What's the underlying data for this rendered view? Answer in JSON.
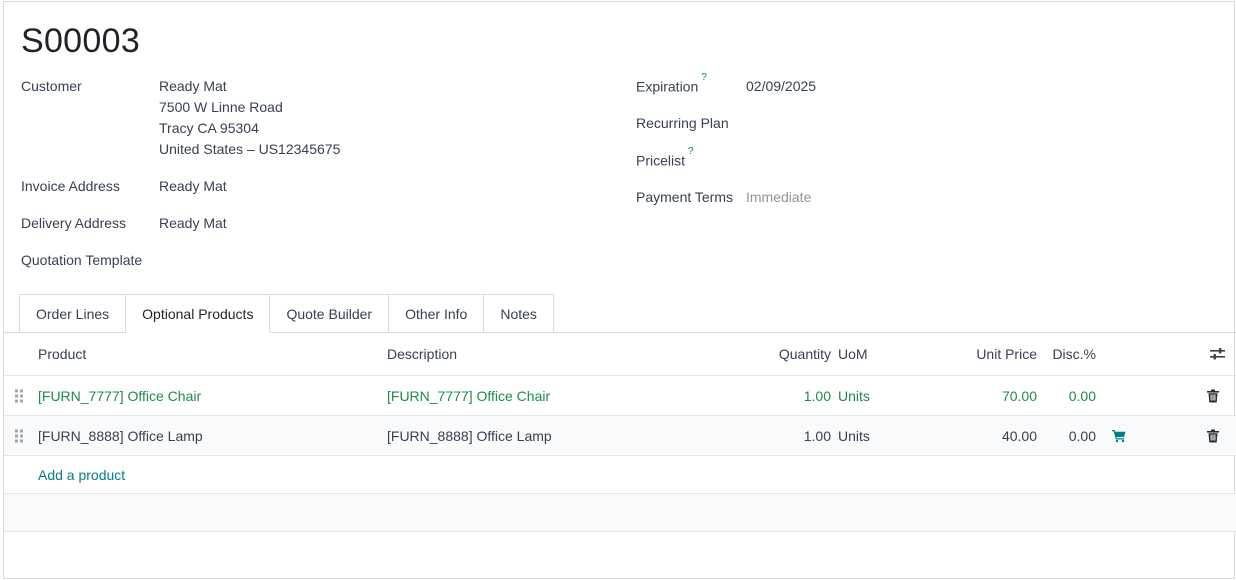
{
  "record": {
    "title": "S00003"
  },
  "left_fields": {
    "customer": {
      "label": "Customer",
      "lines": [
        "Ready Mat",
        "7500 W Linne Road",
        "Tracy CA 95304",
        "United States – US12345675"
      ]
    },
    "invoice_address": {
      "label": "Invoice Address",
      "value": "Ready Mat"
    },
    "delivery_address": {
      "label": "Delivery Address",
      "value": "Ready Mat"
    },
    "quotation_template": {
      "label": "Quotation Template",
      "value": ""
    }
  },
  "right_fields": {
    "expiration": {
      "label": "Expiration",
      "help": "?",
      "value": "02/09/2025"
    },
    "recurring_plan": {
      "label": "Recurring Plan",
      "value": ""
    },
    "pricelist": {
      "label": "Pricelist",
      "help": "?",
      "value": ""
    },
    "payment_terms": {
      "label": "Payment Terms",
      "placeholder": "Immediate"
    }
  },
  "tabs": [
    {
      "label": "Order Lines",
      "active": false
    },
    {
      "label": "Optional Products",
      "active": true
    },
    {
      "label": "Quote Builder",
      "active": false
    },
    {
      "label": "Other Info",
      "active": false
    },
    {
      "label": "Notes",
      "active": false
    }
  ],
  "table": {
    "headers": {
      "product": "Product",
      "description": "Description",
      "quantity": "Quantity",
      "uom": "UoM",
      "unit_price": "Unit Price",
      "discount": "Disc.%"
    },
    "rows": [
      {
        "product": "[FURN_7777] Office Chair",
        "description": "[FURN_7777] Office Chair",
        "quantity": "1.00",
        "uom": "Units",
        "unit_price": "70.00",
        "discount": "0.00",
        "added": true
      },
      {
        "product": "[FURN_8888] Office Lamp",
        "description": "[FURN_8888] Office Lamp",
        "quantity": "1.00",
        "uom": "Units",
        "unit_price": "40.00",
        "discount": "0.00",
        "added": false
      }
    ],
    "add_label": "Add a product"
  },
  "colors": {
    "accent_teal": "#017e84",
    "added_green": "#1f8a4c",
    "border": "#d8dadd"
  },
  "icons": {
    "column_settings": "sliders-icon",
    "drag": "drag-handle-icon",
    "delete": "trash-icon",
    "add_to_order": "cart-icon"
  }
}
